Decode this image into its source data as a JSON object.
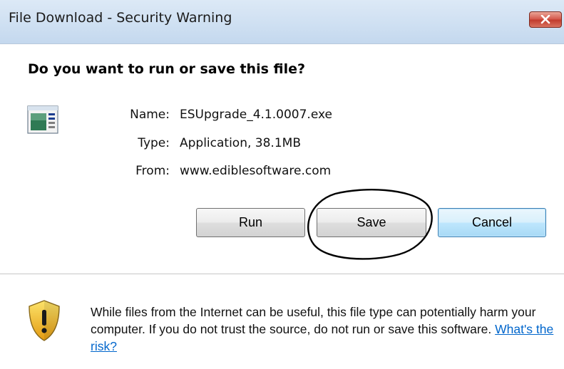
{
  "window": {
    "title": "File Download - Security Warning",
    "close_icon": "close-icon"
  },
  "dialog": {
    "heading": "Do you want to run or save this file?",
    "file_icon": "application-file-icon",
    "fields": [
      {
        "label": "Name:",
        "value": "ESUpgrade_4.1.0007.exe"
      },
      {
        "label": "Type:",
        "value": "Application, 38.1MB"
      },
      {
        "label": "From:",
        "value": "www.ediblesoftware.com"
      }
    ]
  },
  "buttons": {
    "run": "Run",
    "save": "Save",
    "cancel": "Cancel"
  },
  "footer": {
    "icon": "warning-shield-icon",
    "warning_text": "While files from the Internet can be useful, this file type can potentially harm your computer. If you do not trust the source, do not run or save this software.",
    "risk_link": "What's the risk?"
  },
  "colors": {
    "titlebar": "#cfe0f2",
    "link": "#0066cc",
    "default_button_border": "#3c7fb1",
    "annotation_ellipse": "#000000"
  }
}
